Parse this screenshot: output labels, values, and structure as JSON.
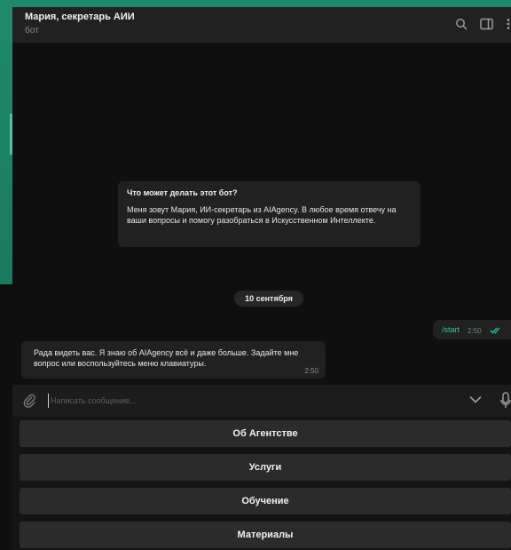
{
  "header": {
    "title": "Мария, секретарь АИИ",
    "subtitle": "бот"
  },
  "bot_info": {
    "question": "Что может делать этот бот?",
    "answer": "Меня зовут Мария, ИИ-секретарь из AIAgency. В любое время отвечу на ваши вопросы  и помогу разобраться в Искусственном Интеллекте."
  },
  "date_badge": "10 сентября",
  "messages": [
    {
      "direction": "outgoing",
      "text": "/start",
      "time": "2:50",
      "status": "read"
    },
    {
      "direction": "incoming",
      "text": "Рада видеть вас. Я знаю об AIAgency всё и даже больше. Задайте мне вопрос или воспользуйтесь меню клавиатуры.",
      "time": "2:50"
    }
  ],
  "composer": {
    "placeholder": "Написать сообщение..."
  },
  "keyboard": {
    "buttons": [
      "Об Агентстве",
      "Услуги",
      "Обучение",
      "Материалы"
    ]
  },
  "icons": [
    "search-icon",
    "sidebar-toggle-icon",
    "more-icon",
    "attach-icon",
    "chevron-down-icon",
    "microphone-icon",
    "double-check-icon"
  ],
  "colors": {
    "accent": "#33c3a5",
    "background": "#0f0f10",
    "bubble": "#212121",
    "button": "#2b2b2b"
  }
}
